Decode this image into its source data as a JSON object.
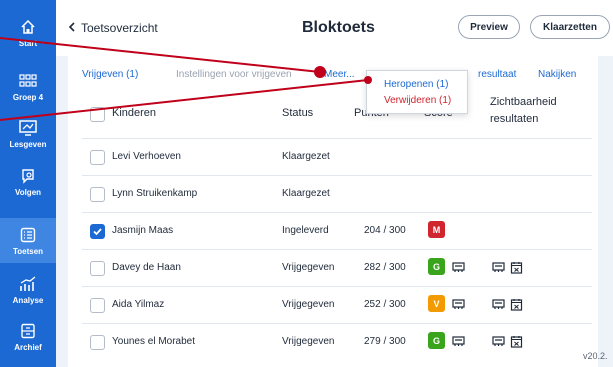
{
  "colors": {
    "primary": "#1c69d3",
    "red": "#d0242f",
    "green": "#39a41c",
    "orange": "#f39a00",
    "annotation": "#c0001a"
  },
  "sidebar": {
    "items": [
      {
        "label": "Start",
        "icon": "home-icon"
      },
      {
        "label": "Groep 4",
        "icon": "group-icon"
      },
      {
        "label": "Lesgeven",
        "icon": "teach-icon"
      },
      {
        "label": "Volgen",
        "icon": "follow-icon"
      },
      {
        "label": "Toetsen",
        "icon": "tests-icon"
      },
      {
        "label": "Analyse",
        "icon": "analysis-icon"
      },
      {
        "label": "Archief",
        "icon": "archive-icon"
      }
    ]
  },
  "header": {
    "back_label": "Toetsoverzicht",
    "title": "Bloktoets",
    "preview_label": "Preview",
    "ready_label": "Klaarzetten"
  },
  "tabs": {
    "vrijgeven": "Vrijgeven (1)",
    "instellingen": "Instellingen voor vrijgeven",
    "meer": "Meer...",
    "resultaat": "resultaat",
    "nakijken": "Nakijken"
  },
  "dropdown": {
    "heropenen": "Heropenen (1)",
    "verwijderen": "Verwijderen (1)"
  },
  "table": {
    "headers": {
      "kinderen": "Kinderen",
      "status": "Status",
      "punten": "Punten",
      "score": "Score",
      "zichtbaarheid_1": "Zichtbaarheid",
      "zichtbaarheid_2": "resultaten"
    },
    "rows": [
      {
        "name": "Levi Verhoeven",
        "status": "Klaargezet",
        "points": "",
        "score": "",
        "checked": false
      },
      {
        "name": "Lynn Struikenkamp",
        "status": "Klaargezet",
        "points": "",
        "score": "",
        "checked": false
      },
      {
        "name": "Jasmijn Maas",
        "status": "Ingeleverd",
        "points": "204 / 300",
        "score": "M",
        "checked": true
      },
      {
        "name": "Davey de Haan",
        "status": "Vrijgegeven",
        "points": "282 / 300",
        "score": "G",
        "checked": false
      },
      {
        "name": "Aida Yilmaz",
        "status": "Vrijgegeven",
        "points": "252 / 300",
        "score": "V",
        "checked": false
      },
      {
        "name": "Younes el Morabet",
        "status": "Vrijgegeven",
        "points": "279 / 300",
        "score": "G",
        "checked": false
      }
    ]
  },
  "version": "v20.2."
}
